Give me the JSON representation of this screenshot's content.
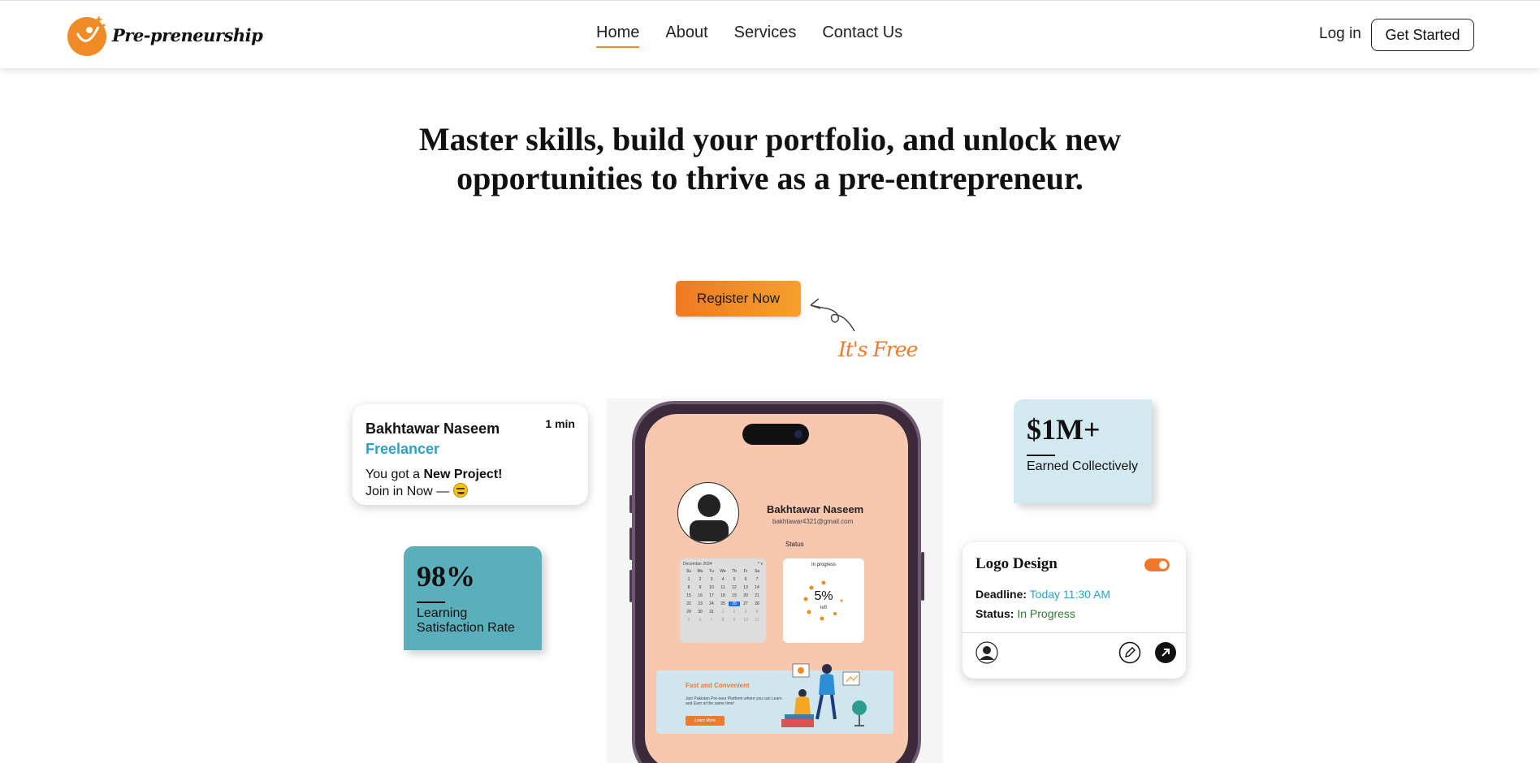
{
  "header": {
    "brand": "Pre-preneurship",
    "nav": [
      "Home",
      "About",
      "Services",
      "Contact Us"
    ],
    "login": "Log in",
    "cta": "Get Started"
  },
  "hero": {
    "title": "Master skills, build your portfolio, and unlock new opportunities to thrive as a pre-entrepreneur.",
    "register": "Register Now",
    "free_note": "It's Free"
  },
  "notification": {
    "name": "Bakhtawar Naseem",
    "role": "Freelancer",
    "time": "1 min",
    "msg_prefix": "You got a ",
    "msg_bold": "New Project!",
    "msg_line2": "Join in Now — "
  },
  "stats": {
    "learning": {
      "value": "98%",
      "label": "Learning Satisfaction Rate"
    },
    "earned": {
      "value": "$1M+",
      "label": "Earned Collectively"
    }
  },
  "task": {
    "title": "Logo Design",
    "deadline_label": "Deadline:",
    "deadline_value": "Today 11:30 AM",
    "status_label": "Status:",
    "status_value": "In Progress",
    "toggle_on": true
  },
  "phone": {
    "name": "Bakhtawar Naseem",
    "email": "bakhtawar4321@gmail.com",
    "status_label": "Status",
    "calendar_month": "December 2024",
    "weekdays": [
      "Su",
      "Mo",
      "Tu",
      "We",
      "Th",
      "Fr",
      "Sa"
    ],
    "days": [
      "1",
      "2",
      "3",
      "4",
      "5",
      "6",
      "7",
      "8",
      "9",
      "10",
      "11",
      "12",
      "13",
      "14",
      "15",
      "16",
      "17",
      "18",
      "19",
      "20",
      "21",
      "22",
      "23",
      "24",
      "25",
      "26",
      "27",
      "28",
      "29",
      "30",
      "31",
      "1",
      "2",
      "3",
      "4",
      "5",
      "6",
      "7",
      "8",
      "9",
      "10",
      "11"
    ],
    "selected_day": "26",
    "progress_label": "In progress",
    "progress_value": "5%",
    "progress_sub": "left",
    "banner_title": "Fast and Convenient",
    "banner_text": "Join Pakistan Pre-neur Platform where you can Learn and Earn at the same time!",
    "banner_btn": "Learn More"
  },
  "colors": {
    "accent": "#f07a2c",
    "teal": "#5aafbb",
    "light_blue": "#d3e9f0",
    "link_blue": "#2ba3c6",
    "phone_screen": "#f8c7b0"
  }
}
